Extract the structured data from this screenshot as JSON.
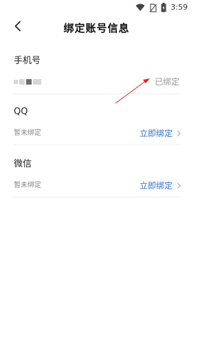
{
  "status_bar": {
    "time": "3:59",
    "icons": [
      "wifi-icon",
      "no-sim-icon",
      "battery-charging-icon"
    ]
  },
  "header": {
    "back_icon": "chevron-left-icon",
    "title": "绑定账号信息"
  },
  "sections": {
    "phone": {
      "title": "手机号",
      "value_masked": true,
      "status": "已绑定"
    },
    "qq": {
      "title": "QQ",
      "status": "暂未绑定",
      "action": "立即绑定",
      "action_icon": "chevron-right-icon"
    },
    "wechat": {
      "title": "微信",
      "status": "暂未绑定",
      "action": "立即绑定",
      "action_icon": "chevron-right-icon"
    }
  },
  "colors": {
    "accent": "#2f6fd6",
    "annotation_arrow": "#e02020",
    "muted_text": "#888888",
    "divider": "#eeeeee"
  }
}
